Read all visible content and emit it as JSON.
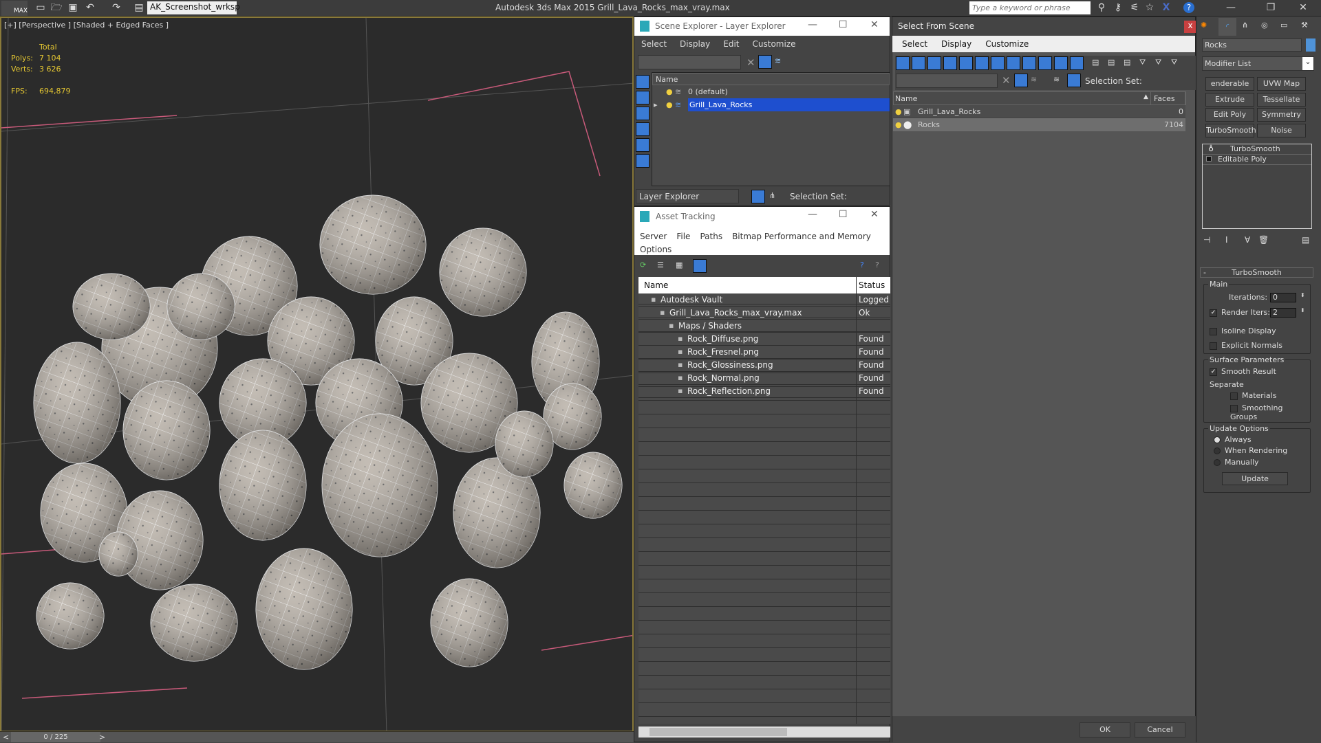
{
  "topbar": {
    "app_logo": "MAX",
    "workspace": "AK_Screenshot_wrksp",
    "title": "Autodesk 3ds Max  2015    Grill_Lava_Rocks_max_vray.max",
    "search_placeholder": "Type a keyword or phrase",
    "icons": [
      "new-file-icon",
      "open-folder-icon",
      "save-icon",
      "undo-icon",
      "redo-icon",
      "project-folder-icon",
      "binoculars-icon",
      "key-icon",
      "satellite-icon",
      "star-icon",
      "x-exchange-icon",
      "help-icon"
    ]
  },
  "viewport": {
    "label": "[+] [Perspective ] [Shaded + Edged Faces ]",
    "stats": {
      "header": "Total",
      "polys_label": "Polys:",
      "polys": "7 104",
      "verts_label": "Verts:",
      "verts": "3 626",
      "fps_label": "FPS:",
      "fps": "694,879"
    }
  },
  "timeline": {
    "frame": "0 / 225",
    "prev": "<",
    "next": ">"
  },
  "scene_explorer": {
    "title": "Scene Explorer - Layer Explorer",
    "menu": [
      "Select",
      "Display",
      "Edit",
      "Customize"
    ],
    "column": "Name",
    "rows": [
      "0 (default)",
      "Grill_Lava_Rocks"
    ],
    "selected": "Grill_Lava_Rocks",
    "footer_mode": "Layer Explorer",
    "selection_set_label": "Selection Set:"
  },
  "asset_tracking": {
    "title": "Asset Tracking",
    "menu": [
      "Server",
      "File",
      "Paths",
      "Bitmap Performance and Memory",
      "Options"
    ],
    "columns": [
      "Name",
      "Status"
    ],
    "rows": [
      {
        "name": "Autodesk Vault",
        "status": "Logged",
        "level": 1
      },
      {
        "name": "Grill_Lava_Rocks_max_vray.max",
        "status": "Ok",
        "level": 2
      },
      {
        "name": "Maps / Shaders",
        "status": "",
        "level": 3
      },
      {
        "name": "Rock_Diffuse.png",
        "status": "Found",
        "level": 4
      },
      {
        "name": "Rock_Fresnel.png",
        "status": "Found",
        "level": 4
      },
      {
        "name": "Rock_Glossiness.png",
        "status": "Found",
        "level": 4
      },
      {
        "name": "Rock_Normal.png",
        "status": "Found",
        "level": 4
      },
      {
        "name": "Rock_Reflection.png",
        "status": "Found",
        "level": 4
      }
    ]
  },
  "select_from_scene": {
    "title": "Select From Scene",
    "close": "x",
    "menu": [
      "Select",
      "Display",
      "Customize"
    ],
    "selection_set_label": "Selection Set:",
    "columns": [
      "Name",
      "Faces"
    ],
    "rows": [
      {
        "name": "Grill_Lava_Rocks",
        "faces": "0"
      },
      {
        "name": "Rocks",
        "faces": "7104"
      }
    ],
    "selected": "Rocks",
    "ok": "OK",
    "cancel": "Cancel"
  },
  "command_panel": {
    "object_name": "Rocks",
    "object_color": "#4f93d8",
    "modifier_list": "Modifier List",
    "modifier_buttons": [
      "enderable Splin",
      "UVW Map",
      "Extrude",
      "Tessellate",
      "Edit Poly",
      "Symmetry",
      "TurboSmooth",
      "Noise"
    ],
    "stack": [
      "TurboSmooth",
      "Editable Poly"
    ],
    "rollout": {
      "title": "TurboSmooth",
      "collapse": "-",
      "main": "Main",
      "iterations_label": "Iterations:",
      "iterations": "0",
      "render_iters_label": "Render Iters:",
      "render_iters": "2",
      "render_iters_checked": true,
      "isoline": "Isoline Display",
      "isoline_checked": false,
      "explicit_normals": "Explicit Normals",
      "explicit_normals_checked": false,
      "surface": "Surface Parameters",
      "smooth_result": "Smooth Result",
      "smooth_result_checked": true,
      "separate": "Separate",
      "materials": "Materials",
      "smoothing_groups": "Smoothing Groups",
      "update_options": "Update Options",
      "always": "Always",
      "when_rendering": "When Rendering",
      "manually": "Manually",
      "selected_update": "Always",
      "update_button": "Update"
    }
  },
  "colors": {
    "accent": "#3a7bd5",
    "selection": "#1e4fcf",
    "stats": "#e6c832",
    "viewport_border": "#8a7a3a"
  }
}
